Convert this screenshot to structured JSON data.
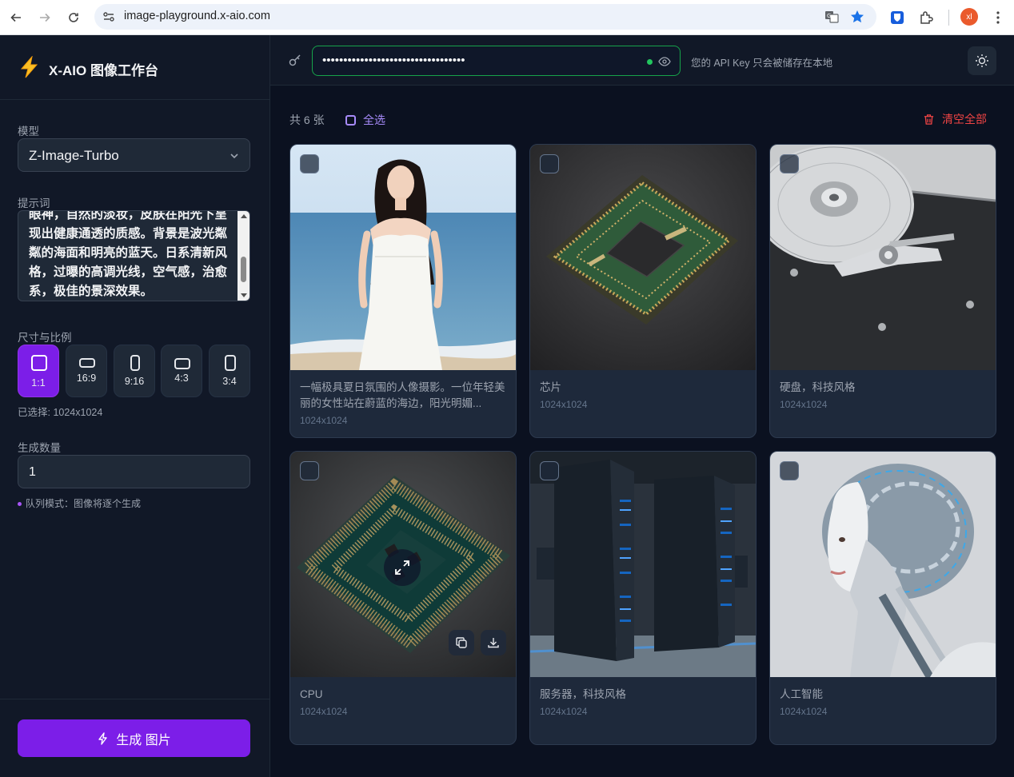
{
  "browser": {
    "url": "image-playground.x-aio.com",
    "profile_initial": "xl"
  },
  "sidebar": {
    "brand_title": "X-AIO 图像工作台",
    "model_label": "模型",
    "model_value": "Z-Image-Turbo",
    "prompt_label": "提示词",
    "prompt_text": "眼神，自然的淡妆，皮肤在阳光下呈现出健康通透的质感。背景是波光粼粼的海面和明亮的蓝天。日系清新风格，过曝的高调光线，空气感，治愈系，极佳的景深效果。",
    "ratio_label": "尺寸与比例",
    "ratios": [
      {
        "label": "1:1",
        "active": true
      },
      {
        "label": "16:9",
        "active": false
      },
      {
        "label": "9:16",
        "active": false
      },
      {
        "label": "4:3",
        "active": false
      },
      {
        "label": "3:4",
        "active": false
      }
    ],
    "selected_info": "已选择: 1024x1024",
    "count_label": "生成数量",
    "count_value": "1",
    "queue_note": "队列模式：图像将逐个生成",
    "generate_label": "生成 图片"
  },
  "topbar": {
    "api_key_masked": "••••••••••••••••••••••••••••••••••",
    "api_key_note": "您的 API Key 只会被储存在本地"
  },
  "gallery": {
    "count_text": "共 6 张",
    "select_all": "全选",
    "clear_all": "清空全部",
    "accent": "#7c1ee8",
    "items": [
      {
        "caption": "一幅极具夏日氛围的人像摄影。一位年轻美丽的女性站在蔚蓝的海边，阳光明媚...",
        "size": "1024x1024",
        "image": "portrait-beach"
      },
      {
        "caption": "芯片",
        "size": "1024x1024",
        "image": "chip"
      },
      {
        "caption": "硬盘，科技风格",
        "size": "1024x1024",
        "image": "hard-drive"
      },
      {
        "caption": "CPU",
        "size": "1024x1024",
        "image": "cpu"
      },
      {
        "caption": "服务器，科技风格",
        "size": "1024x1024",
        "image": "server-rack"
      },
      {
        "caption": "人工智能",
        "size": "1024x1024",
        "image": "ai-robot"
      }
    ]
  }
}
